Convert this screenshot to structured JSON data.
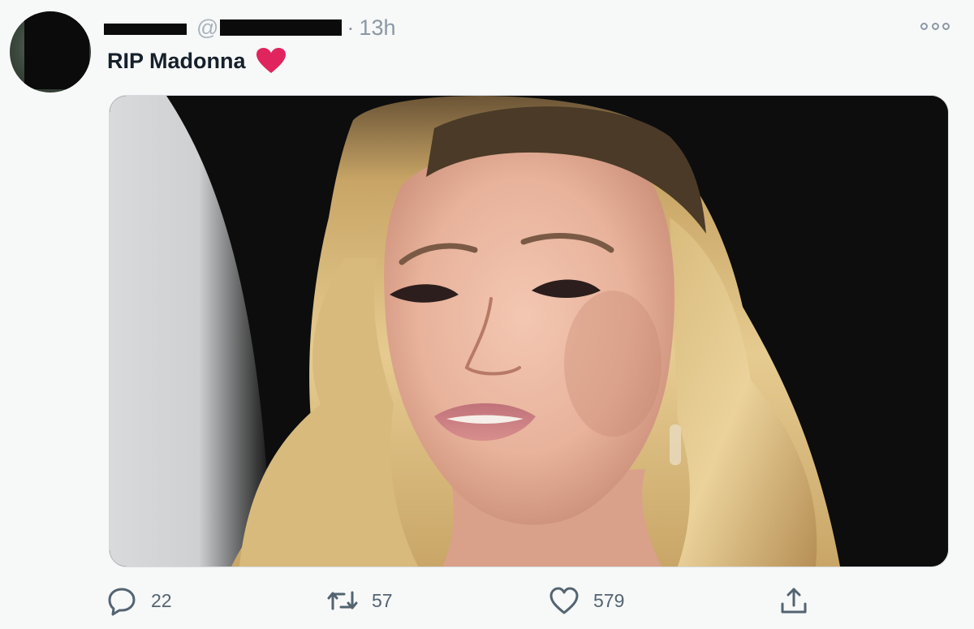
{
  "tweet": {
    "handle_prefix": "@",
    "separator": "·",
    "time": "13h",
    "text": "RIP Madonna",
    "emoji": "red-heart",
    "media": {
      "kind": "photo",
      "subject": "portrait of a woman with wavy blonde hair"
    },
    "actions": {
      "reply_count": "22",
      "retweet_count": "57",
      "like_count": "579"
    }
  },
  "icons": {
    "more": "more-horizontal-icon",
    "reply": "reply-icon",
    "retweet": "retweet-icon",
    "like": "like-icon",
    "share": "share-icon"
  },
  "colors": {
    "heart": "#e0245e",
    "muted": "#536471",
    "background": "#f7f8f8"
  }
}
